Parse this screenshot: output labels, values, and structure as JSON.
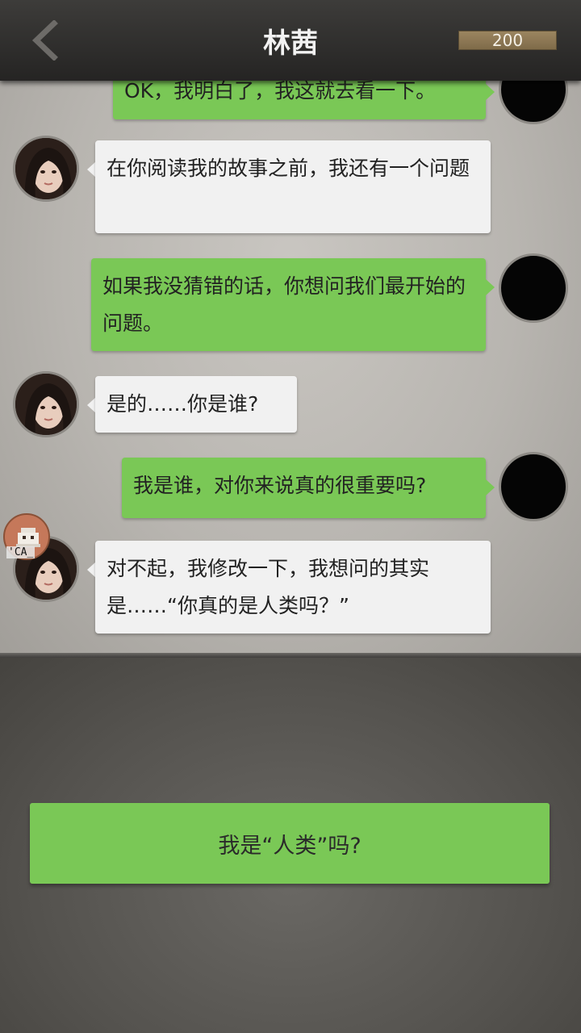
{
  "header": {
    "title": "林茜",
    "coins": "200"
  },
  "messages": [
    {
      "side": "right",
      "text": "OK，我明白了，我这就去看一下。"
    },
    {
      "side": "left",
      "text": "在你阅读我的故事之前，我还有一个问题"
    },
    {
      "side": "right",
      "text": "如果我没猜错的话，你想问我们最开始的问题。"
    },
    {
      "side": "left",
      "text": "是的……你是谁?"
    },
    {
      "side": "right",
      "text": "我是谁，对你来说真的很重要吗?"
    },
    {
      "side": "left",
      "text": "对不起，我修改一下，我想问的其实是……“你真的是人类吗？”"
    }
  ],
  "overlay_badge": {
    "text": "'CA_"
  },
  "choices": [
    {
      "label": "我是“人类”吗?"
    }
  ],
  "colors": {
    "player_bubble": "#7ac856",
    "npc_bubble": "#f1f1f1",
    "topbar": "#2f2e2c",
    "coin_bar": "#8c7654"
  }
}
